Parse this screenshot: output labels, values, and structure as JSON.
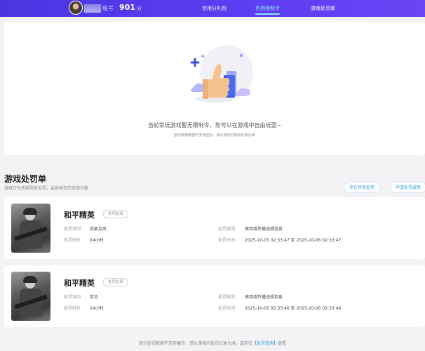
{
  "header": {
    "user_suffix": "账号",
    "score": "901",
    "score_unit": "分",
    "nav": [
      "信用分礼包",
      "信用限制令",
      "游戏处罚单"
    ]
  },
  "status": {
    "main": "当前常玩游戏暂无限制令，您可以在游戏中自由玩耍~",
    "sub": "部分限制数据不支持显示，请以游戏内限制记录为准"
  },
  "section": {
    "title": "游戏处罚单",
    "subtitle": "游戏行为违规导致处罚，会影响您的信用分数",
    "buttons": [
      "存在异常处罚",
      "申请处罚减免"
    ]
  },
  "labels": {
    "reason": "处罚说明",
    "duration": "处罚时长",
    "cause": "处罚原因",
    "time": "处罚时间",
    "sep": "至"
  },
  "penalties": [
    {
      "game": "和平精英",
      "badge": "处罚结束",
      "reason": "禁麦克风",
      "duration": "24小时",
      "cause": "使用或传播违规信息",
      "start": "2025-10-05 02:33:47",
      "end": "2025-10-06 02:33:47"
    },
    {
      "game": "和平精英",
      "badge": "处罚结束",
      "reason": "禁言",
      "duration": "24小时",
      "cause": "使用或传播违规信息",
      "start": "2025-10-05 02:33:46",
      "end": "2025-10-06 02:33:46"
    }
  ],
  "footer": {
    "text_before": "部分处罚数据不支持展示，请以游戏内处罚记录为准，或前往",
    "link": "【处罚查询】",
    "text_after": "查看"
  },
  "colors": {
    "header_gradient": [
      "#4a35e0",
      "#6a45f5"
    ],
    "active_nav": "#8ee6ff",
    "link": "#2f9bd6"
  },
  "icons": [
    "user-avatar",
    "thumbs-up-illustration"
  ]
}
